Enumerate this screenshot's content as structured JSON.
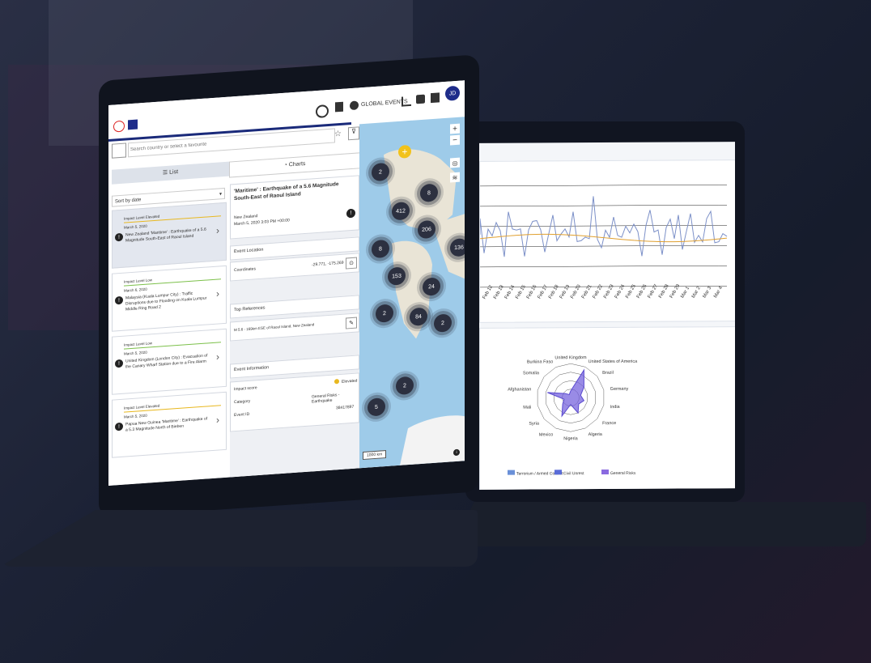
{
  "header": {
    "global_events_label": "GLOBAL EVENTS",
    "avatar_initials": "JD"
  },
  "search": {
    "placeholder": "Search country or select a favourite"
  },
  "tabs": [
    {
      "label": "List"
    },
    {
      "label": "Charts"
    }
  ],
  "sort": {
    "label": "Sort by date"
  },
  "events": [
    {
      "impact": "Impact Level Elevated",
      "date": "March 5, 2020",
      "title": "New Zealand 'Maritime' : Earthquake of a 5.6 Magnitude South-East of Raoul Island",
      "color": "#e8b820"
    },
    {
      "impact": "Impact Level Low",
      "date": "March 6, 2020",
      "title": "Malaysia (Kuala Lumpur City) : Traffic Disruptions due to Flooding on Kuala Lumpur Middle Ring Road 2",
      "color": "#7cc04a"
    },
    {
      "impact": "Impact Level Low",
      "date": "March 5, 2020",
      "title": "United Kingdom (London City) : Evacuation of the Canary Wharf Station due to a Fire Alarm",
      "color": "#7cc04a"
    },
    {
      "impact": "Impact Level Elevated",
      "date": "March 5, 2020",
      "title": "Papua New Guinea 'Maritime' : Earthquake of a 5.3 Magnitude North of Bieben",
      "color": "#e8b820"
    }
  ],
  "detail": {
    "title": "'Maritime' : Earthquake of a 5.6 Magnitude South-East of Raoul Island",
    "country": "New Zealand",
    "datetime": "March 5, 2020 3:03 PM +00:00",
    "location_heading": "Event Location",
    "coordinates_label": "Coordinates",
    "coordinates_value": "-29.771, -175.269",
    "references_heading": "Top References",
    "reference_text": "M 5.6 - 169km ESE of Raoul Island, New Zealand",
    "info_heading": "Event Information",
    "impact_label": "Impact score",
    "impact_value": "Elevated",
    "category_label": "Category",
    "category_value": "General Risks - Earthquake",
    "eventid_label": "Event ID",
    "eventid_value": "38417897"
  },
  "map": {
    "clusters": [
      "2",
      "8",
      "412",
      "206",
      "8",
      "136",
      "153",
      "24",
      "2",
      "84",
      "2",
      "2",
      "5"
    ],
    "scale_label": "1000 km"
  },
  "line_chart": {
    "x_labels": [
      "Feb 12",
      "Feb 13",
      "Feb 14",
      "Feb 15",
      "Feb 16",
      "Feb 17",
      "Feb 18",
      "Feb 19",
      "Feb 20",
      "Feb 21",
      "Feb 22",
      "Feb 23",
      "Feb 24",
      "Feb 25",
      "Feb 26",
      "Feb 27",
      "Feb 28",
      "Feb 29",
      "Mar 1",
      "Mar 2",
      "Mar 3",
      "Mar 4"
    ]
  },
  "radar": {
    "labels": [
      "United Kingdom",
      "United States of America",
      "Brazil",
      "Germany",
      "India",
      "France",
      "Algeria",
      "Nigeria",
      "Mexico",
      "Syria",
      "Mali",
      "Afghanistan",
      "Somalia",
      "Burkina Faso"
    ],
    "legend": [
      {
        "name": "Terrorism / Armed Conflict",
        "color": "#6a90d8"
      },
      {
        "name": "Civil Unrest",
        "color": "#5a6cd8"
      },
      {
        "name": "General Risks",
        "color": "#8a6ae0"
      }
    ]
  }
}
